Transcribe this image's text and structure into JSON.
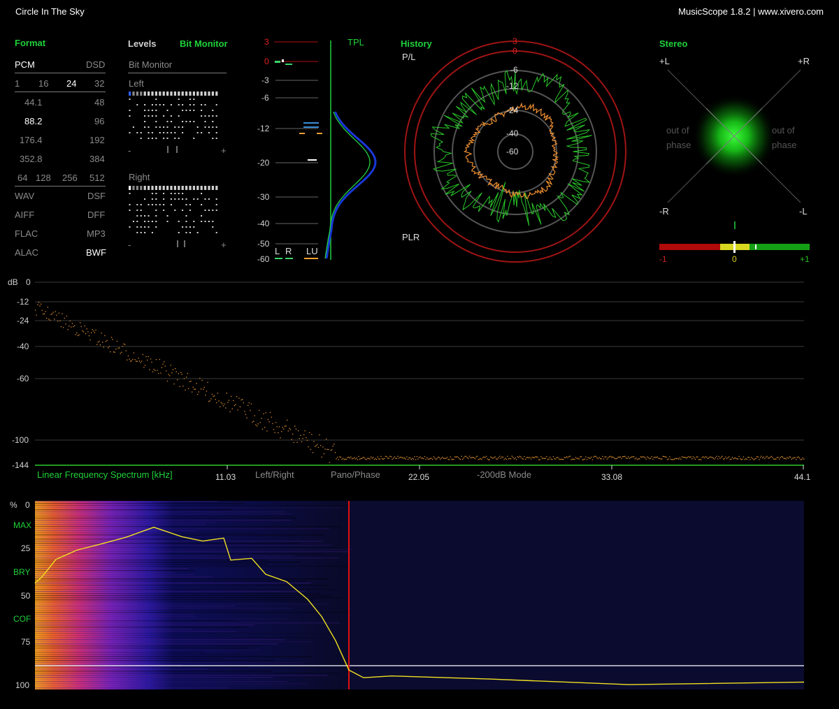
{
  "app": {
    "track_title": "Circle In The Sky",
    "version": "MusicScope 1.8.2 | www.xivero.com"
  },
  "format": {
    "header": "Format",
    "row1": {
      "left": "PCM",
      "right": "DSD"
    },
    "bits": [
      "1",
      "16",
      "24",
      "32"
    ],
    "bits_active": "24",
    "rates": [
      [
        "44.1",
        "48"
      ],
      [
        "88.2",
        "96"
      ],
      [
        "176.4",
        "192"
      ],
      [
        "352.8",
        "384"
      ]
    ],
    "rate_active": "88.2",
    "dsd": [
      "64",
      "128",
      "256",
      "512"
    ],
    "containers": [
      [
        "WAV",
        "DSF"
      ],
      [
        "AIFF",
        "DFF"
      ],
      [
        "FLAC",
        "MP3"
      ],
      [
        "ALAC",
        "BWF"
      ]
    ],
    "container_active": "BWF"
  },
  "levels": {
    "tab_levels": "Levels",
    "tab_bitmon": "Bit Monitor",
    "section_title": "Bit Monitor",
    "left_label": "Left",
    "right_label": "Right",
    "minus": "-",
    "plus": "+"
  },
  "meter": {
    "ticks": [
      "3",
      "0",
      "-3",
      "-6",
      "-12",
      "-20",
      "-30",
      "-40",
      "-50",
      "-60"
    ],
    "tpl_label": "TPL",
    "legend": [
      "L",
      "R",
      "LU"
    ],
    "colors": {
      "L": "#39d46a",
      "R": "#3a8fd8",
      "LU": "#f0a030",
      "red": "#d01010"
    }
  },
  "history": {
    "header": "History",
    "pl": "P/L",
    "plr": "PLR",
    "rings": [
      "3",
      "0",
      "-6",
      "-12",
      "-24",
      "-40",
      "-60"
    ]
  },
  "stereo": {
    "header": "Stereo",
    "corners": {
      "tl": "+L",
      "tr": "+R",
      "bl": "-R",
      "br": "-L"
    },
    "out_of_phase": "out of phase",
    "scale": {
      "left": "-1",
      "mid": "0",
      "right": "+1"
    },
    "correlation_value": 0.0
  },
  "spectrum": {
    "db_unit": "dB",
    "y_ticks": [
      "0",
      "-12",
      "-24",
      "-40",
      "-60",
      "-100",
      "-144"
    ],
    "label": "Linear Frequency Spectrum [kHz]",
    "x_ticks": [
      "11.03",
      "22.05",
      "33.08",
      "44.1"
    ],
    "modes": [
      "Left/Right",
      "Pano/Phase",
      "-200dB Mode"
    ]
  },
  "spectrogram": {
    "pct_unit": "%",
    "y_ticks": [
      "0",
      "25",
      "50",
      "75",
      "100"
    ],
    "markers": [
      "MAX",
      "BRY",
      "COF"
    ]
  }
}
